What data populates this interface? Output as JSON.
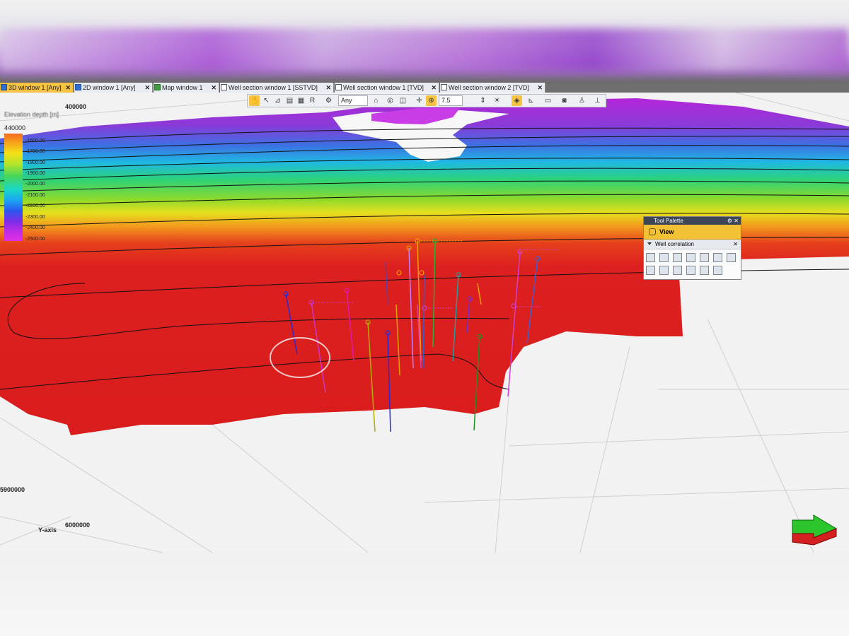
{
  "tabs": [
    {
      "label": "3D window 1 [Any]",
      "active": true
    },
    {
      "label": "2D window 1 [Any]",
      "active": false
    },
    {
      "label": "Map window 1",
      "active": false
    },
    {
      "label": "Well section window 1 [SSTVD]",
      "active": false
    },
    {
      "label": "Well section window 1 [TVD]",
      "active": false
    },
    {
      "label": "Well section window 2 [TVD]",
      "active": false
    }
  ],
  "toolbar": {
    "domain_select": "Any",
    "zoom_value": "7.5"
  },
  "legend": {
    "title": "Elevation depth [m]",
    "top_label": "440000",
    "ticks": [
      "-1600.00",
      "-1700.00",
      "-1800.00",
      "-1900.00",
      "-2000.00",
      "-2100.00",
      "-2200.00",
      "-2300.00",
      "-2400.00",
      "-2500.00"
    ]
  },
  "axes": {
    "x_label_top": "400000",
    "y_label_left": "5900000",
    "y_label_bottom": "6000000",
    "y_axis_name": "Y-axis"
  },
  "tool_palette": {
    "title": "Tool Palette",
    "mode": "View",
    "section": "Well correlation"
  },
  "colors": {
    "active_tab": "#f5c242",
    "surface_red": "#dc1f1f",
    "highlight_circle": "#d63c3c"
  }
}
